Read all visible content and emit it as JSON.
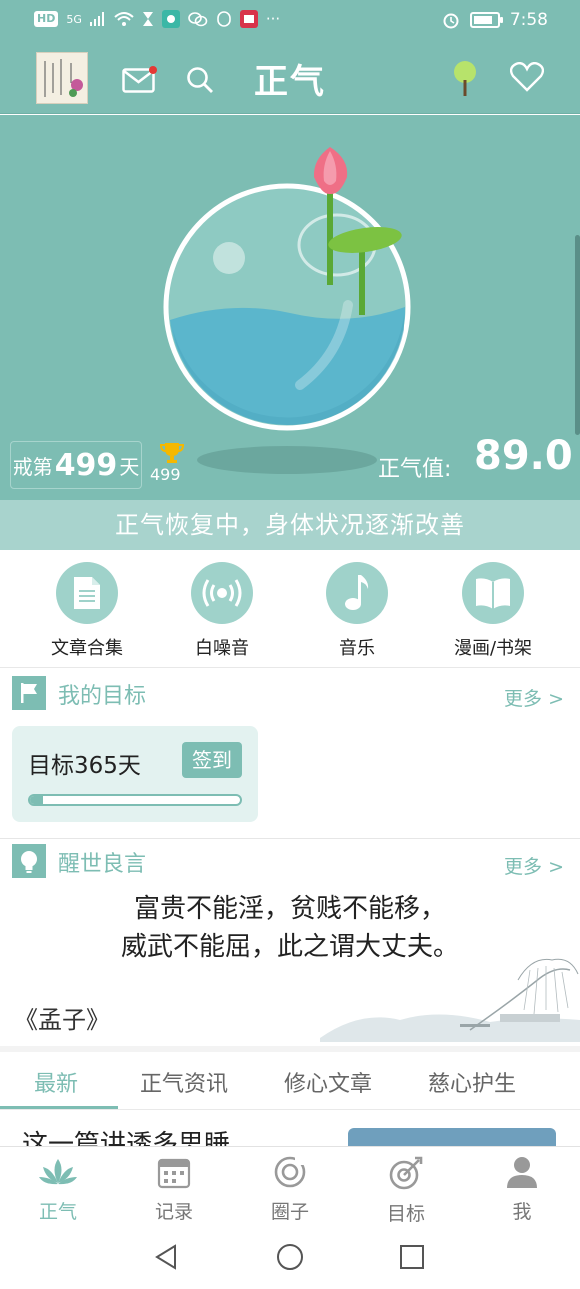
{
  "status_bar": {
    "left_chip": "HD",
    "signal": "5G",
    "more": "···",
    "time": "7:58"
  },
  "header": {
    "title": "正气"
  },
  "hero": {
    "streak_prefix": "戒第",
    "streak_days": "499",
    "streak_suffix": "天",
    "trophy_count": "499",
    "zhengqi_label": "正气值:",
    "zhengqi_value": "89.0",
    "status_message": "正气恢复中，身体状况逐渐改善"
  },
  "features": [
    {
      "label": "文章合集",
      "icon": "document-icon"
    },
    {
      "label": "白噪音",
      "icon": "radio-waves-icon"
    },
    {
      "label": "音乐",
      "icon": "music-note-icon"
    },
    {
      "label": "漫画/书架",
      "icon": "book-icon"
    }
  ],
  "goals": {
    "title": "我的目标",
    "more": "更多 >",
    "card_title": "目标365天",
    "checkin_label": "签到",
    "progress": 0.06
  },
  "wisdom": {
    "title": "醒世良言",
    "more": "更多 >",
    "line1": "富贵不能淫，贫贱不能移，",
    "line2": "威武不能屈，此之谓大丈夫。",
    "source": "《孟子》"
  },
  "tabs": [
    {
      "label": "最新",
      "active": true
    },
    {
      "label": "正气资讯",
      "active": false
    },
    {
      "label": "修心文章",
      "active": false
    },
    {
      "label": "慈心护生",
      "active": false
    }
  ],
  "article_peek": "这一篇讲透多思睡",
  "bottom_nav": [
    {
      "label": "正气",
      "icon": "lotus-icon",
      "active": true
    },
    {
      "label": "记录",
      "icon": "calendar-icon",
      "active": false
    },
    {
      "label": "圈子",
      "icon": "circle-icon",
      "active": false
    },
    {
      "label": "目标",
      "icon": "target-icon",
      "active": false
    },
    {
      "label": "我",
      "icon": "person-icon",
      "active": false
    }
  ],
  "colors": {
    "accent": "#7dbdb3",
    "banner": "#a8d3cd",
    "lotus": "#ef6f86",
    "leaf": "#7cc242",
    "water": "#5bb6cc"
  }
}
